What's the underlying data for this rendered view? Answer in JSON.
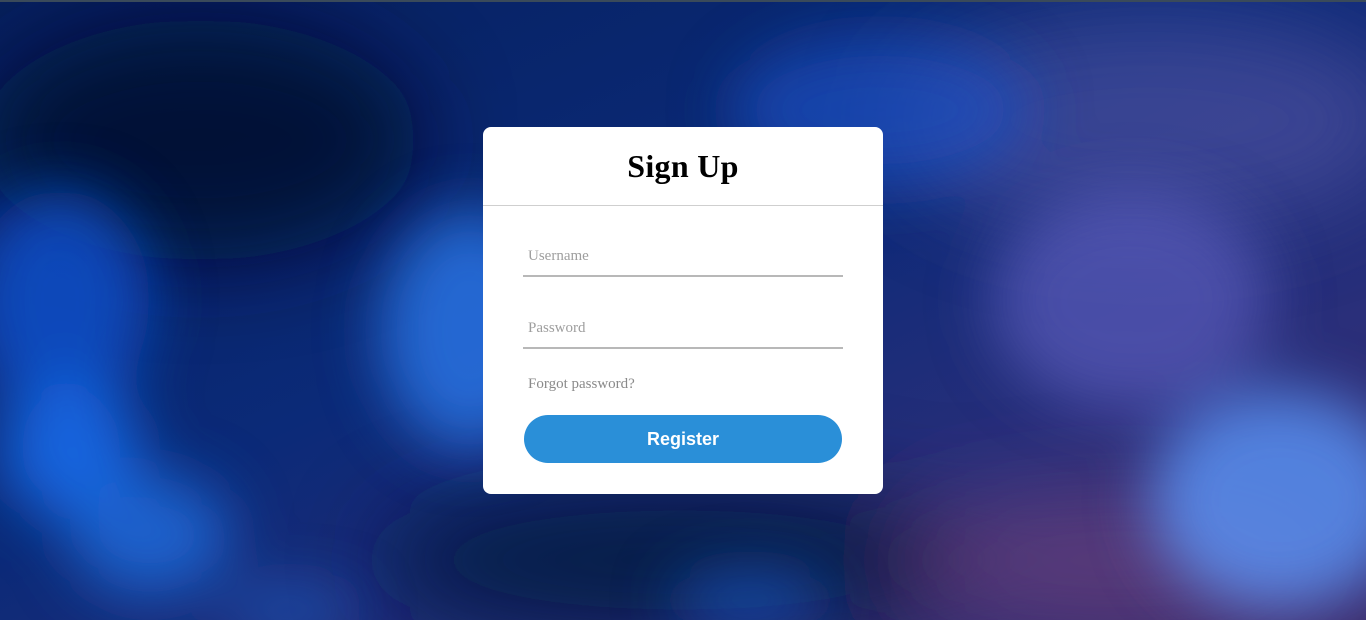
{
  "signup_card": {
    "title": "Sign Up",
    "username": {
      "placeholder": "Username",
      "value": ""
    },
    "password": {
      "placeholder": "Password",
      "value": ""
    },
    "forgot_password_label": "Forgot password?",
    "register_label": "Register"
  },
  "colors": {
    "background_primary": "#0a1f5c",
    "card_background": "#ffffff",
    "register_button": "#2a8fd8",
    "input_underline": "#b8b8b8",
    "placeholder_text": "#9e9e9e"
  }
}
